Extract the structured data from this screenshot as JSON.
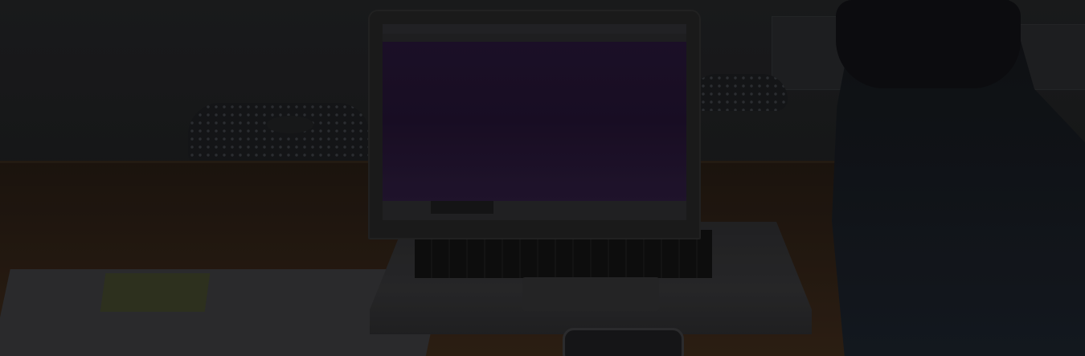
{
  "scene": {
    "description_colors": {
      "overlay": "#00000040",
      "screen_accent": "#241534",
      "table_wood": "#2c1f15"
    },
    "icons": [
      "laptop-icon",
      "phone-icon",
      "chair-icon",
      "paper-icon"
    ]
  }
}
